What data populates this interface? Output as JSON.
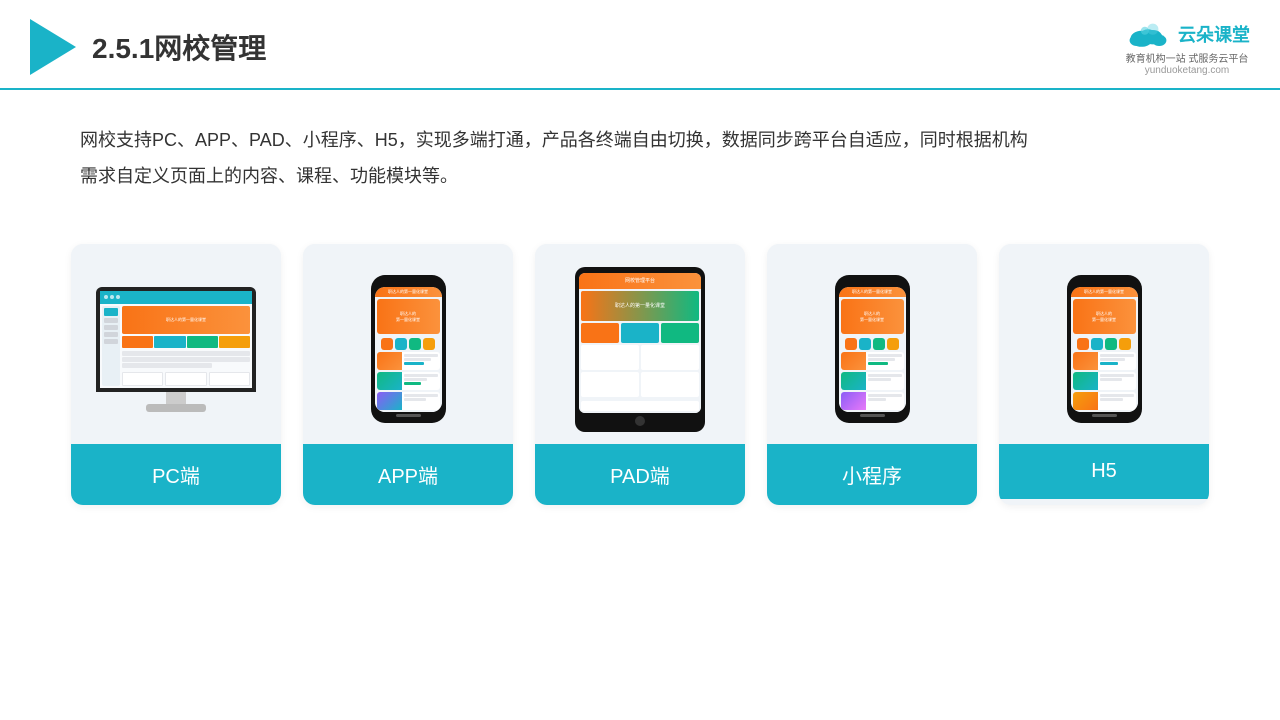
{
  "header": {
    "title": "2.5.1网校管理",
    "brand_name": "云朵课堂",
    "brand_url": "yunduoketang.com",
    "brand_tagline": "教育机构一站\n式服务云平台"
  },
  "description": {
    "text": "网校支持PC、APP、PAD、小程序、H5，实现多端打通，产品各终端自由切换，数据同步跨平台自适应，同时根据机构需求自定义页面上的内容、课程、功能模块等。"
  },
  "cards": [
    {
      "id": "pc",
      "label": "PC端"
    },
    {
      "id": "app",
      "label": "APP端"
    },
    {
      "id": "pad",
      "label": "PAD端"
    },
    {
      "id": "miniapp",
      "label": "小程序"
    },
    {
      "id": "h5",
      "label": "H5"
    }
  ],
  "colors": {
    "primary": "#1ab3c8",
    "accent_orange": "#f97316",
    "accent_green": "#10b981",
    "card_bg": "#f0f4f8",
    "label_bg": "#1ab3c8"
  }
}
